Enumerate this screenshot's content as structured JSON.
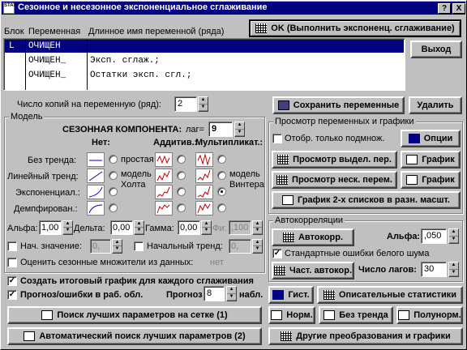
{
  "window": {
    "title": "Сезонное и несезонное экспоненциальное сглаживание",
    "help": "?",
    "close": "X",
    "icon_text": "STAT"
  },
  "vars": {
    "col_block": "Блок",
    "col_var": "Переменная",
    "col_long": "Длинное имя переменной (ряда)",
    "rows": [
      {
        "block": "L",
        "var": "ОЧИЩЕН",
        "long": ""
      },
      {
        "block": "",
        "var": "ОЧИЩЕН_",
        "long": "Эксп. сглаж.;"
      },
      {
        "block": "",
        "var": "ОЧИЩЕН_",
        "long": "Остатки эксп. сгл.;"
      }
    ]
  },
  "buttons": {
    "ok": "OK (Выполнить экспоненц. сглаживание)",
    "exit": "Выход",
    "save": "Сохранить переменные",
    "delete": "Удалить",
    "options": "Опции",
    "view_sel": "Просмотр выдел. пер.",
    "view_multi": "Просмотр неск. перем.",
    "graph": "График",
    "graph_two": "График 2-х списков в разн. масшт.",
    "autocorr": "Автокорр.",
    "partial_autocorr": "Част. автокор.",
    "hist": "Гист.",
    "desc_stats": "Описательные статистики",
    "grid_search": "Поиск лучших параметров на сетке (1)",
    "auto_search": "Автоматический поиск лучших параметров (2)",
    "norm": "Норм.",
    "no_trend": "Без тренда",
    "halfnorm": "Полунорм.",
    "other": "Другие преобразования и графики"
  },
  "copies": {
    "label": "Число копий на переменную (ряд):",
    "value": "2"
  },
  "model": {
    "title": "Модель",
    "seasonal_label": "СЕЗОННАЯ КОМПОНЕНТА:",
    "lag_label": "лаг=",
    "lag_value": "9",
    "col_none": "Нет:",
    "col_add": "Аддитив.:",
    "col_mult": "Мультипликат.:",
    "row_labels": [
      "Без тренда:",
      "Линейный тренд:",
      "Экспоненциал.:",
      "Демпфирован.:"
    ],
    "simple": "простая",
    "holt": "модель Холта",
    "winters": "модель Винтера",
    "alpha_label": "Альфа:",
    "alpha": "1,00",
    "delta_label": "Дельта:",
    "delta": "0,00",
    "gamma_label": "Гамма:",
    "gamma": "0,00",
    "phi_label": "Фи:",
    "phi": ",100",
    "init_value_label": "Нач. значение:",
    "init_value": "0,",
    "init_trend_label": "Начальный тренд:",
    "init_trend": "0,",
    "estimate_label": "Оценить сезонные множители из данных:",
    "estimate_value": "нет"
  },
  "view": {
    "title": "Просмотр переменных и графики",
    "only_sub": "Отобр. только подмнож."
  },
  "autocorr": {
    "title": "Автокорреляции",
    "alpha_label": "Альфа:",
    "alpha": ",050",
    "std_errors": "Стандартные ошибки белого шума",
    "lags_label": "Число лагов:",
    "lags": "30"
  },
  "final": {
    "create_graph": "Создать итоговый график для каждого сглаживания",
    "forecast": "Прогноз/ошибки в раб. обл.",
    "forecast_label": "Прогноз",
    "forecast_n": "8",
    "obs": "набл."
  }
}
